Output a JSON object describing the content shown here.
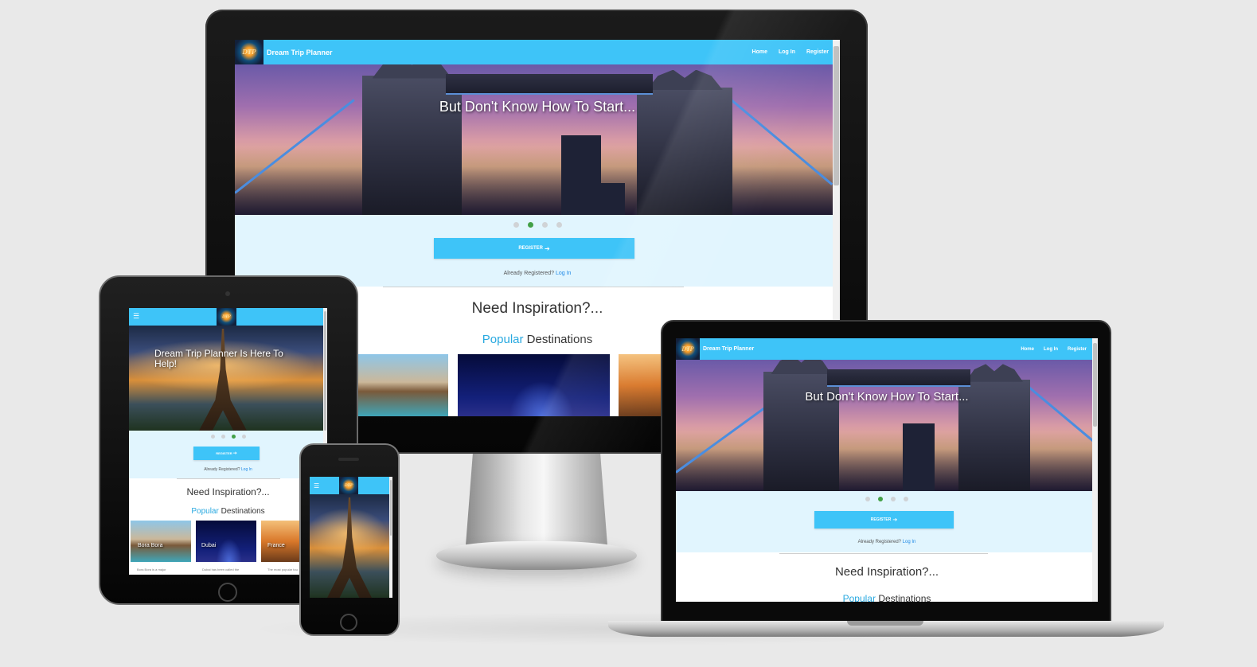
{
  "site": {
    "brand": "Dream Trip Planner",
    "logo_text": "DTP",
    "nav": [
      "Home",
      "Log In",
      "Register"
    ]
  },
  "hero": {
    "caption_bridge": "But Don't Know How To Start...",
    "caption_paris": "Dream Trip Planner Is Here To Help!"
  },
  "carousel": {
    "count": 4,
    "active_desktop": 1,
    "active_tablet": 2
  },
  "cta": {
    "register_label": "REGISTER",
    "register_icon": "sign-in-icon",
    "already_prefix": "Already Registered?",
    "login_link": "Log In"
  },
  "inspiration": {
    "heading": "Need Inspiration?...",
    "popular_accent": "Popular",
    "popular_rest": "Destinations"
  },
  "destinations": [
    {
      "name": "Bora Bora",
      "snippet": "Bora Bora is a major"
    },
    {
      "name": "Dubai",
      "snippet": "Dubai has been called the"
    },
    {
      "name": "France",
      "snippet": "The most popular tou"
    }
  ],
  "colors": {
    "navbar": "#3ec4f8",
    "band": "#e1f5fe",
    "accent": "#29a9e0",
    "dot_active": "#43a047",
    "link": "#1e88e5"
  }
}
